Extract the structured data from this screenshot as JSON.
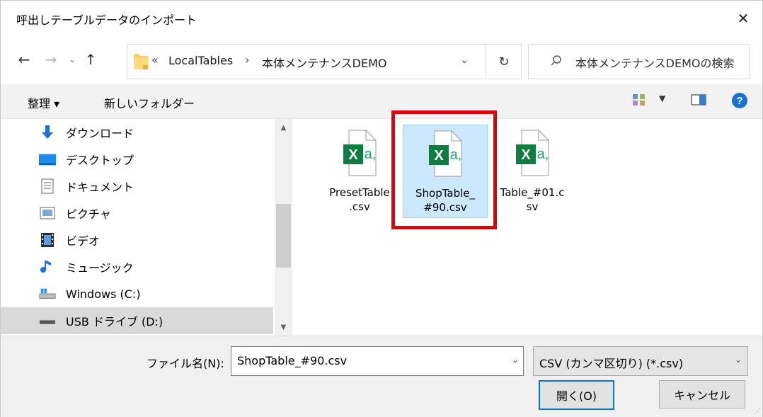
{
  "window": {
    "title": "呼出しテーブルデータのインポート",
    "close_glyph": "✕"
  },
  "address": {
    "overflow": "«",
    "segments": [
      "LocalTables",
      "本体メンテナンスDEMO"
    ],
    "separator": "›",
    "search_placeholder": "本体メンテナンスDEMOの検索"
  },
  "toolbar": {
    "organize_label": "整理 ▾",
    "new_folder_label": "新しいフォルダー"
  },
  "nav": {
    "items": [
      {
        "label": "ダウンロード",
        "icon": "download-arrow-icon"
      },
      {
        "label": "デスクトップ",
        "icon": "desktop-icon"
      },
      {
        "label": "ドキュメント",
        "icon": "document-icon"
      },
      {
        "label": "ピクチャ",
        "icon": "picture-icon"
      },
      {
        "label": "ビデオ",
        "icon": "video-icon"
      },
      {
        "label": "ミュージック",
        "icon": "music-note-icon"
      },
      {
        "label": "Windows (C:)",
        "icon": "system-drive-icon"
      },
      {
        "label": "USB ドライブ (D:)",
        "icon": "usb-drive-icon",
        "selected": true
      }
    ]
  },
  "files": [
    {
      "name_line1": "PresetTable",
      "name_line2": ".csv"
    },
    {
      "name_line1": "ShopTable_",
      "name_line2": "#90.csv",
      "selected": true
    },
    {
      "name_line1": "Table_#01.c",
      "name_line2": "sv"
    }
  ],
  "bottom": {
    "filename_label": "ファイル名(N):",
    "filename_value": "ShopTable_#90.csv",
    "filetype_value": "CSV (カンマ区切り) (*.csv)",
    "open_label": "開く(O)",
    "cancel_label": "キャンセル"
  },
  "colors": {
    "highlight": "#e00000",
    "selection": "#cce8ff",
    "excel_green": "#107c41",
    "accent": "#0078d7"
  }
}
